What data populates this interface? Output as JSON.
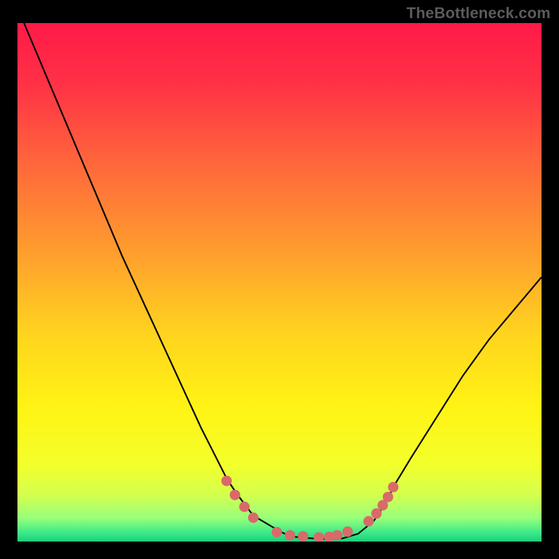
{
  "watermark": "TheBottleneck.com",
  "chart_data": {
    "type": "line",
    "title": "",
    "xlabel": "",
    "ylabel": "",
    "xlim": [
      0,
      100
    ],
    "ylim": [
      0,
      100
    ],
    "series": [
      {
        "name": "curve",
        "x": [
          0,
          5,
          10,
          15,
          20,
          25,
          30,
          35,
          40,
          42,
          45,
          50,
          52,
          55,
          58,
          60,
          62,
          65,
          68,
          70,
          72,
          75,
          80,
          85,
          90,
          95,
          100
        ],
        "y": [
          103,
          91,
          79,
          67,
          55,
          44,
          33,
          22,
          12,
          9,
          5,
          2,
          1,
          0.7,
          0.5,
          0.5,
          0.6,
          1.5,
          4,
          7,
          11,
          16,
          24,
          32,
          39,
          45,
          51
        ]
      }
    ],
    "markers": {
      "name": "dots",
      "x": [
        39.9,
        41.5,
        43.3,
        45,
        49.5,
        52,
        54.5,
        57.5,
        59.5,
        61,
        63,
        67,
        68.5,
        69.7,
        70.7,
        71.7
      ],
      "y": [
        11.7,
        9,
        6.7,
        4.6,
        1.8,
        1.2,
        1,
        0.8,
        0.9,
        1.2,
        1.9,
        3.9,
        5.4,
        7,
        8.6,
        10.5
      ]
    },
    "gradient_stops": [
      {
        "offset": 0.0,
        "color": "#ff1a47"
      },
      {
        "offset": 0.12,
        "color": "#ff3246"
      },
      {
        "offset": 0.28,
        "color": "#ff6a3a"
      },
      {
        "offset": 0.45,
        "color": "#ffa02d"
      },
      {
        "offset": 0.6,
        "color": "#ffd41e"
      },
      {
        "offset": 0.74,
        "color": "#fff314"
      },
      {
        "offset": 0.85,
        "color": "#f3ff2a"
      },
      {
        "offset": 0.91,
        "color": "#d4ff4e"
      },
      {
        "offset": 0.955,
        "color": "#97ff7b"
      },
      {
        "offset": 0.985,
        "color": "#35e889"
      },
      {
        "offset": 1.0,
        "color": "#1dcf77"
      }
    ],
    "marker_color": "#d86a6a",
    "curve_color": "#000000"
  }
}
